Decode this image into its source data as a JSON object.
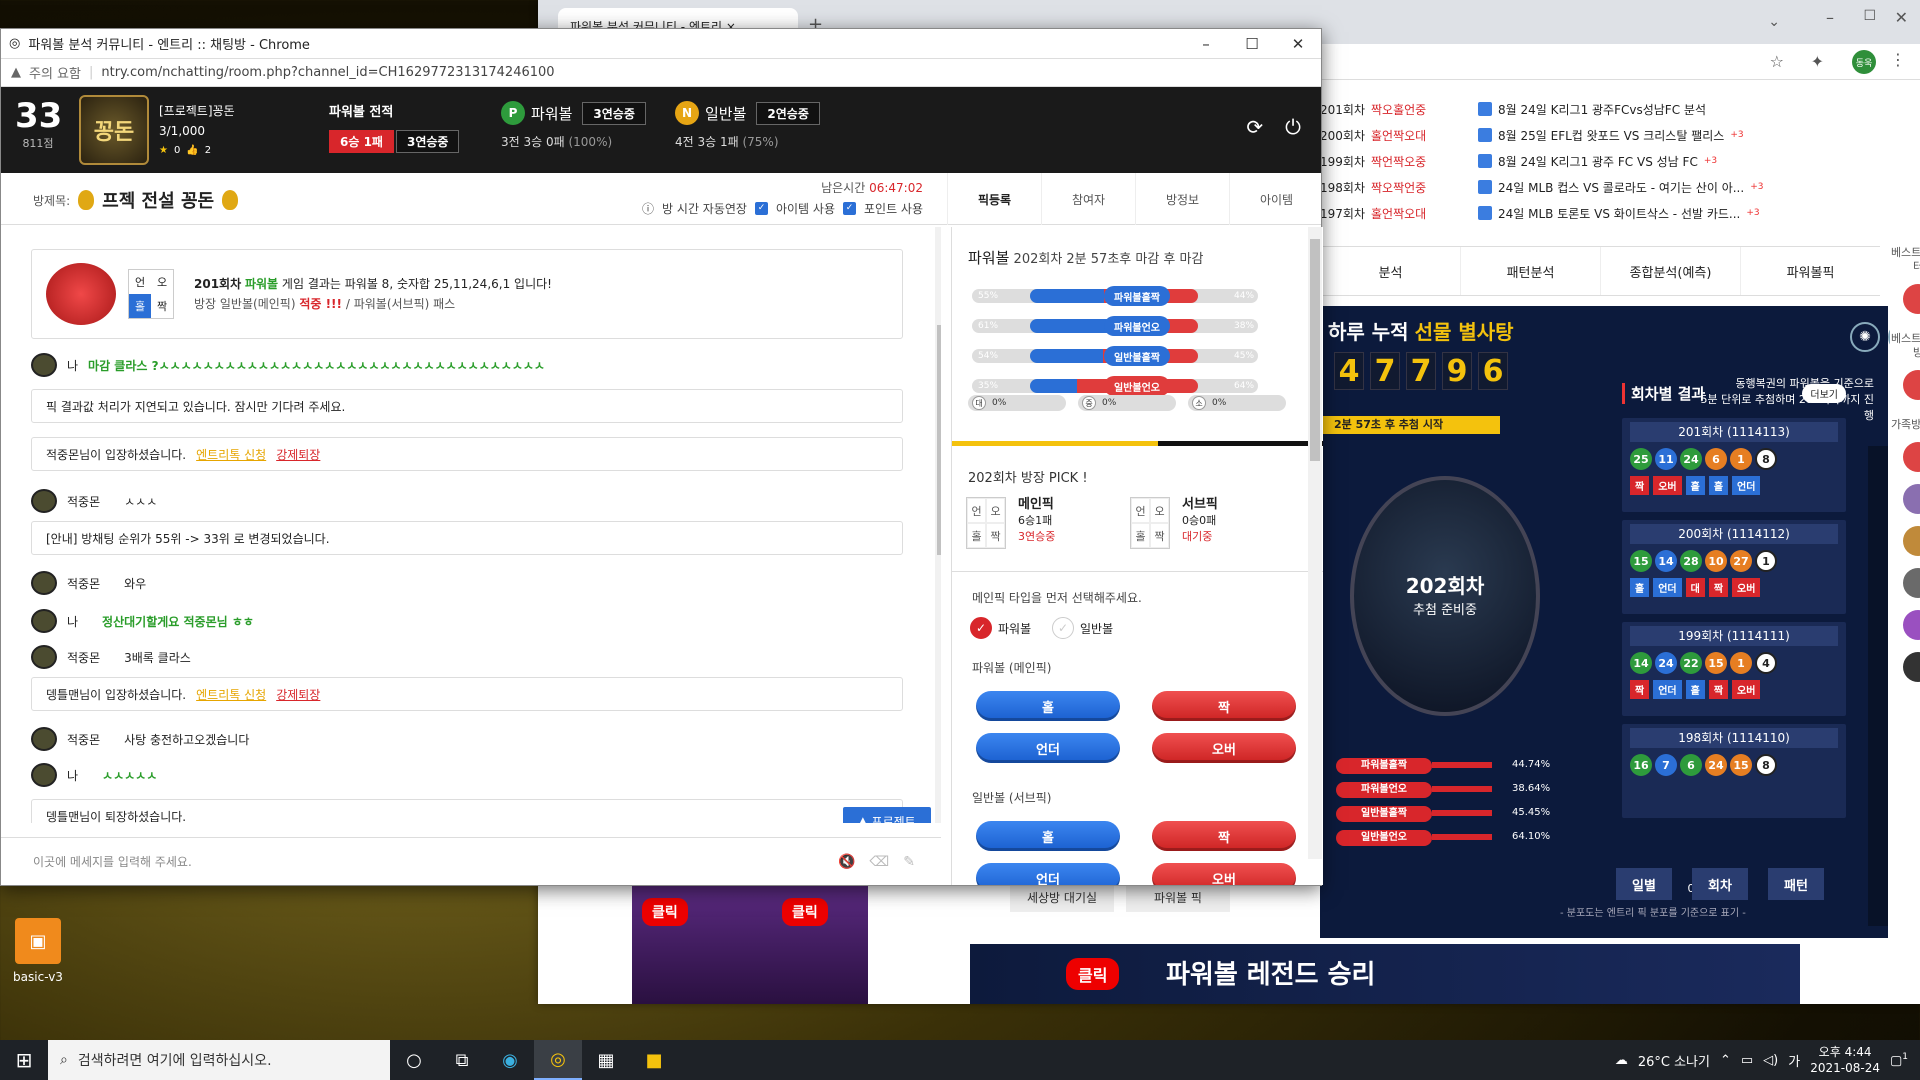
{
  "desktop": {
    "icon_label": "basic-v3"
  },
  "taskbar": {
    "search_placeholder": "검색하려면 여기에 입력하십시오.",
    "weather": "26°C 소나기",
    "time": "오후 4:44",
    "date": "2021-08-24",
    "notif": "1"
  },
  "bg_browser": {
    "tab_title": "파워볼 분석 커뮤니티 - 엔트리",
    "profile": "동욱",
    "news": [
      {
        "t": "8월 24일 K리그1 광주FCvs성남FC 분석",
        "plus": ""
      },
      {
        "t": "8월 25일 EFL컵 왓포드 VS 크리스탈 팰리스",
        "plus": "+3"
      },
      {
        "t": "8월 24일 K리그1 광주 FC VS 성남 FC",
        "plus": "+3"
      },
      {
        "t": "24일 MLB 컵스 VS 콜로라도 - 여기는 산이 아...",
        "plus": "+3"
      },
      {
        "t": "24일 MLB 토론토 VS 화이트삭스 - 선발 카드...",
        "plus": "+3"
      }
    ],
    "results": [
      {
        "r": "201회차",
        "v": "짝오홀언중"
      },
      {
        "r": "200회차",
        "v": "홀언짝오대"
      },
      {
        "r": "199회차",
        "v": "짝언짝오중"
      },
      {
        "r": "198회차",
        "v": "짝오짝언중"
      },
      {
        "r": "197회차",
        "v": "홀언짝오대"
      }
    ],
    "nav": [
      "분석",
      "패턴분석",
      "종합분석(예측)",
      "파워볼픽"
    ],
    "banner_title": "하루 누적",
    "banner_highlight": "선물 별사탕",
    "digits": [
      "4",
      "7",
      "7",
      "9",
      "6"
    ],
    "promo1": "동행복권의 파워볼을 기준으로",
    "promo2": "5분 단위로 추첨하며 288회차까지 진행",
    "countdown": "2분 57초 후 추첨 시작",
    "draw_round": "202회차",
    "draw_text": "추첨 준비중",
    "section_title": "회차별 결과",
    "more": "더보기",
    "rounds": [
      {
        "title": "201회차 (1114113)",
        "balls": [
          "25",
          "11",
          "24",
          "6",
          "1",
          "8"
        ],
        "tags": [
          "짝",
          "오버",
          "홀",
          "홀",
          "언더"
        ]
      },
      {
        "title": "200회차 (1114112)",
        "balls": [
          "15",
          "14",
          "28",
          "10",
          "27",
          "1"
        ],
        "tags": [
          "홀",
          "언더",
          "대",
          "짝",
          "오버"
        ]
      },
      {
        "title": "199회차 (1114111)",
        "balls": [
          "14",
          "24",
          "22",
          "15",
          "1",
          "4"
        ],
        "tags": [
          "짝",
          "언더",
          "홀",
          "짝",
          "오버"
        ]
      },
      {
        "title": "198회차 (1114110)",
        "balls": [
          "16",
          "7",
          "6",
          "24",
          "15",
          "8"
        ],
        "tags": []
      }
    ],
    "bottom_buttons": [
      "일별",
      "회차",
      "패턴"
    ],
    "stat_bars": [
      {
        "label": "파워볼홀짝",
        "pct": "44.74%"
      },
      {
        "label": "파워볼언오",
        "pct": "38.64%"
      },
      {
        "label": "일반볼홀짝",
        "pct": "45.45%"
      },
      {
        "label": "일반볼언오",
        "pct": "64.10%"
      }
    ],
    "stat_zero1": "0%",
    "stat_zero2": "0%",
    "footnote": "- 분포도는 엔트리 픽 분포를 기준으로 표기 -",
    "btn_left": "세상방 대기실",
    "btn_right": "파워볼 픽",
    "youtube": "클릭",
    "legend_banner": "파워볼 레전드 승리",
    "side": [
      {
        "t": "베스트 픽스터"
      },
      {
        "t": "베스트 가족방"
      },
      {
        "t": "가족방 랭킹"
      }
    ]
  },
  "win": {
    "title": "파워볼 분석 커뮤니티 - 엔트리 :: 채팅방 - Chrome",
    "warning": "주의 요함",
    "url": "ntry.com/nchatting/room.php?channel_id=CH1629772313174246100"
  },
  "header": {
    "rank": "33",
    "points": "811점",
    "logo_text": "꽁돈",
    "user_name": "[프로젝트]꽁돈",
    "members": "3/1,000",
    "star": "0",
    "like": "2",
    "record_label": "파워볼 전적",
    "record_a": "6승 1패",
    "record_b": "3연승중",
    "pb_label": "파워볼",
    "pb_streak": "3연승중",
    "pb_stat": "3전 3승 0패",
    "pb_pct": "(100%)",
    "nb_label": "일반볼",
    "nb_streak": "2연승중",
    "nb_stat": "4전 3승 1패",
    "nb_pct": "(75%)"
  },
  "room": {
    "label": "방제목:",
    "title": "프젝 전설 꽁돈",
    "remain_label": "남은시간",
    "remain_time": "06:47:02",
    "opt1": "방 시간 자동연장",
    "opt2": "아이템 사용",
    "opt3": "포인트 사용",
    "tabs": [
      "픽등록",
      "참여자",
      "방정보",
      "아이템"
    ]
  },
  "chat": {
    "result_round": "201회차",
    "result_game": "파워볼",
    "result_text": "게임 결과는 파워볼 8, 숫자합 25,11,24,6,1 입니다!",
    "result_main": "방장 일반볼(메인픽)",
    "result_hit": "적중 !!!",
    "result_sub": "/ 파워볼(서브픽) 패스",
    "grid": [
      "언",
      "오",
      "홀",
      "짝"
    ],
    "me": "나",
    "m1": "마감 클라스 ?ㅅㅅㅅㅅㅅㅅㅅㅅㅅㅅㅅㅅㅅㅅㅅㅅㅅㅅㅅㅅㅅㅅㅅㅅㅅㅅㅅㅅㅅㅅㅅㅅㅅㅅㅅ",
    "s1": "픽 결과값 처리가 지연되고 있습니다. 잠시만 기다려 주세요.",
    "enter1": "적중몬님이 입장하셨습니다.",
    "entry_apply": "엔트리톡 신청",
    "kick": "강제퇴장",
    "u1": "적중몬",
    "m2": "ㅅㅅㅅ",
    "notice": "[안내] 방채팅 순위가 55위 -> 33위 로 변경되었습니다.",
    "m3": "와우",
    "m4": "정산대기할게요 적중몬님 ㅎㅎ",
    "m5": "3배록 클라스",
    "enter2": "뎅틀맨님이 입장하셨습니다.",
    "m6": "사탕 충전하고오겠습니다",
    "m7": "ㅅㅅㅅㅅㅅ",
    "leave": "뎅틀맨님이 퇴장하셨습니다.",
    "project_btn": "프로젝트",
    "input_placeholder": "이곳에 메세지를 입력해 주세요."
  },
  "panel": {
    "game": "파워볼",
    "round_info": "202회차 2분 57초후 마감 후 마감",
    "bars": [
      {
        "label": "파워볼홀짝",
        "left": "55%",
        "right": "44%",
        "l": 55,
        "color": "#2b6fd6"
      },
      {
        "label": "파워볼언오",
        "left": "61%",
        "right": "38%",
        "l": 61,
        "color": "#2b6fd6"
      },
      {
        "label": "일반볼홀짝",
        "left": "54%",
        "right": "45%",
        "l": 54,
        "color": "#2b6fd6"
      },
      {
        "label": "일반볼언오",
        "left": "35%",
        "right": "64%",
        "l": 35,
        "color": "#e03c3c"
      }
    ],
    "mini": [
      {
        "c": "대",
        "v": "0%"
      },
      {
        "c": "중",
        "v": "0%"
      },
      {
        "c": "소",
        "v": "0%"
      }
    ],
    "pick_title": "202회차 방장 PICK !",
    "main_pick": "메인픽",
    "main_rec": "6승1패",
    "main_status": "3연승중",
    "sub_pick": "서브픽",
    "sub_rec": "0승0패",
    "sub_status": "대기중",
    "select_prompt": "메인픽 타입을 먼저 선택해주세요.",
    "radio_pb": "파워볼",
    "radio_nb": "일반볼",
    "pb_main": "파워볼 (메인픽)",
    "nb_sub": "일반볼 (서브픽)",
    "btn_odd": "홀",
    "btn_even": "짝",
    "btn_under": "언더",
    "btn_over": "오버"
  }
}
